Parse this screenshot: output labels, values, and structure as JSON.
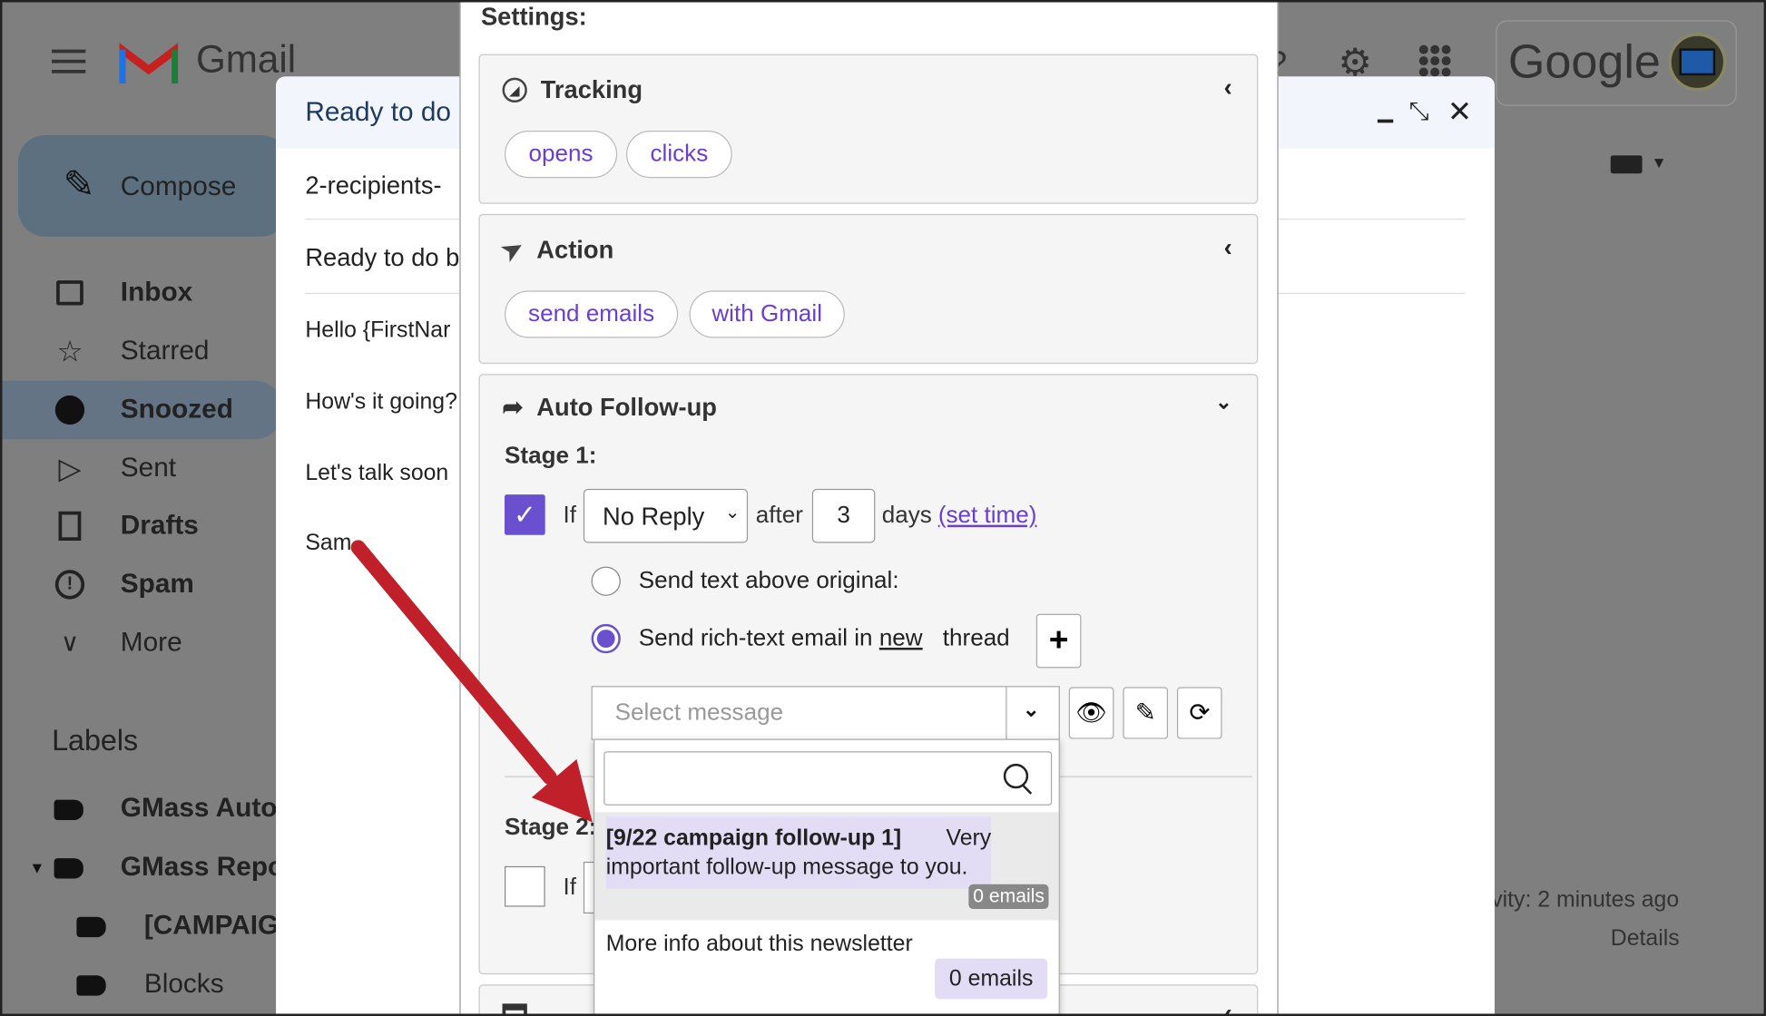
{
  "gmail": {
    "brand": "Gmail",
    "google_label": "Google",
    "compose_label": "Compose",
    "sidebar": [
      {
        "label": "Inbox",
        "icon": "inbox-icon",
        "bold": true
      },
      {
        "label": "Starred",
        "icon": "star-icon",
        "bold": false
      },
      {
        "label": "Snoozed",
        "icon": "clock-icon",
        "bold": true
      },
      {
        "label": "Sent",
        "icon": "send-icon",
        "bold": false
      },
      {
        "label": "Drafts",
        "icon": "draft-icon",
        "bold": true
      },
      {
        "label": "Spam",
        "icon": "spam-icon",
        "bold": true
      },
      {
        "label": "More",
        "icon": "chevron-down-icon",
        "bold": false
      }
    ],
    "labels_heading": "Labels",
    "labels": [
      {
        "label": "GMass Auto"
      },
      {
        "label": "GMass Repo"
      },
      {
        "label": "[CAMPAIG"
      },
      {
        "label": "Blocks"
      }
    ],
    "activity": "vity: 2 minutes ago",
    "details": "Details"
  },
  "compose_window": {
    "header_title": "Ready to do l",
    "to_line": "2-recipients-",
    "subject_line": "Ready to do b",
    "body": [
      "Hello {FirstNar",
      "How's it going?",
      "Let's talk soon",
      "Sam"
    ]
  },
  "settings": {
    "title": "Settings:",
    "tracking": {
      "title": "Tracking",
      "pills": [
        "opens",
        "clicks"
      ]
    },
    "action": {
      "title": "Action",
      "pills": [
        "send emails",
        "with Gmail"
      ]
    },
    "auto_followup": {
      "title": "Auto Follow-up",
      "stage1_label": "Stage 1:",
      "if_label": "If",
      "condition": "No Reply",
      "after_label": "after",
      "days_value": "3",
      "days_label": "days",
      "set_time_link": "(set time)",
      "option_text_above": "Send text above original:",
      "option_rich_prefix": "Send rich-text email in",
      "option_rich_new": "new",
      "option_rich_suffix": "thread",
      "select_placeholder": "Select message",
      "stage2_label": "Stage 2:",
      "stage2_if": "If"
    },
    "dropdown": {
      "search_placeholder": "",
      "items": [
        {
          "title": "[9/22 campaign follow-up 1]",
          "desc_part1": "Very",
          "desc_part2": "important follow-up message to you.",
          "count": "0 emails"
        },
        {
          "title": "More info about this newsletter",
          "count": "0 emails"
        }
      ]
    }
  },
  "colors": {
    "accent": "#6a3fd0",
    "checkbox": "#6a4fcf",
    "arrow": "#c0202a"
  }
}
